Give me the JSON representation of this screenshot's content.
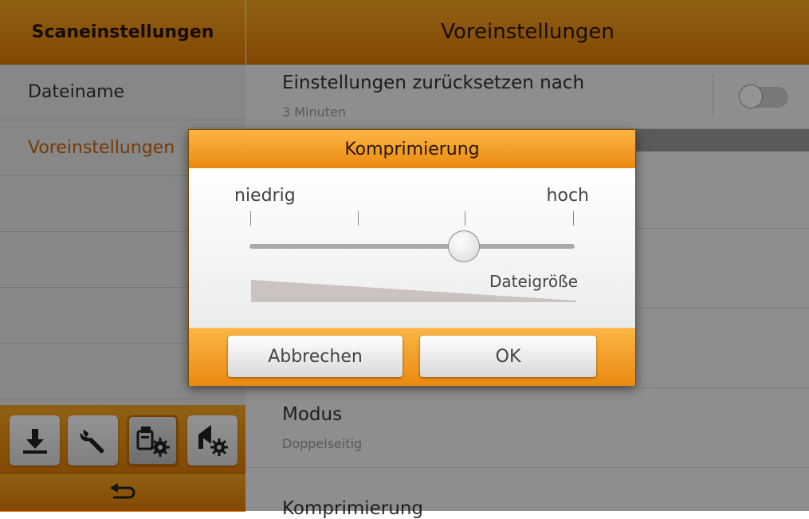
{
  "left": {
    "header": "Scaneinstellungen",
    "items": [
      {
        "label": "Dateiname",
        "active": false
      },
      {
        "label": "Voreinstellungen",
        "active": true
      },
      {
        "label": "",
        "active": false
      },
      {
        "label": "",
        "active": false
      },
      {
        "label": "",
        "active": false
      },
      {
        "label": "",
        "active": false
      }
    ],
    "toolbar": [
      "download-icon",
      "wrench-icon",
      "scanner-settings-icon",
      "upload-settings-icon"
    ],
    "back_icon": "back-arrow-icon"
  },
  "right": {
    "header": "Voreinstellungen",
    "rows": [
      {
        "title": "Einstellungen zurücksetzen nach",
        "subtitle": "3 Minuten",
        "toggle_on": false
      },
      {
        "title": "Modus",
        "subtitle": "Doppelseitig"
      },
      {
        "title": "Komprimierung",
        "subtitle": ""
      }
    ]
  },
  "dialog": {
    "title": "Komprimierung",
    "low_label": "niedrig",
    "high_label": "hoch",
    "filesize_label": "Dateigröße",
    "slider_value": 0.66,
    "cancel_label": "Abbrechen",
    "ok_label": "OK"
  },
  "colors": {
    "accent": "#f39a1a",
    "active_text": "#c8670a"
  }
}
